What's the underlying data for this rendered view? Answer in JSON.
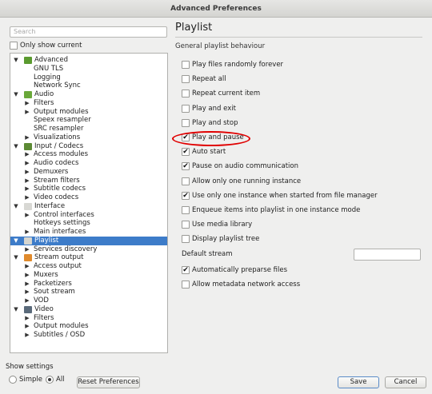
{
  "window": {
    "title": "Advanced Preferences"
  },
  "search": {
    "placeholder": "Search"
  },
  "only_show_current": {
    "label": "Only show current",
    "checked": false
  },
  "tree": [
    {
      "label": "Advanced",
      "level": 0,
      "expanded": true,
      "icon": "advanced-icon",
      "color": "#5a9a2f"
    },
    {
      "label": "GNU TLS",
      "level": 1
    },
    {
      "label": "Logging",
      "level": 1
    },
    {
      "label": "Network Sync",
      "level": 1
    },
    {
      "label": "Audio",
      "level": 0,
      "expanded": true,
      "icon": "audio-icon",
      "color": "#6aa83a"
    },
    {
      "label": "Filters",
      "level": 1,
      "collapsed": true
    },
    {
      "label": "Output modules",
      "level": 1,
      "collapsed": true
    },
    {
      "label": "Speex resampler",
      "level": 1
    },
    {
      "label": "SRC resampler",
      "level": 1
    },
    {
      "label": "Visualizations",
      "level": 1,
      "collapsed": true
    },
    {
      "label": "Input / Codecs",
      "level": 0,
      "expanded": true,
      "icon": "input-codecs-icon",
      "color": "#5c8a34"
    },
    {
      "label": "Access modules",
      "level": 1,
      "collapsed": true
    },
    {
      "label": "Audio codecs",
      "level": 1,
      "collapsed": true
    },
    {
      "label": "Demuxers",
      "level": 1,
      "collapsed": true
    },
    {
      "label": "Stream filters",
      "level": 1,
      "collapsed": true
    },
    {
      "label": "Subtitle codecs",
      "level": 1,
      "collapsed": true
    },
    {
      "label": "Video codecs",
      "level": 1,
      "collapsed": true
    },
    {
      "label": "Interface",
      "level": 0,
      "expanded": true,
      "icon": "interface-icon",
      "color": "#d8d8d4"
    },
    {
      "label": "Control interfaces",
      "level": 1,
      "collapsed": true
    },
    {
      "label": "Hotkeys settings",
      "level": 1
    },
    {
      "label": "Main interfaces",
      "level": 1,
      "collapsed": true
    },
    {
      "label": "Playlist",
      "level": 0,
      "expanded": true,
      "selected": true,
      "icon": "playlist-icon",
      "color": "#d6d6d0"
    },
    {
      "label": "Services discovery",
      "level": 1,
      "collapsed": true
    },
    {
      "label": "Stream output",
      "level": 0,
      "expanded": true,
      "icon": "stream-output-icon",
      "color": "#e08a2c"
    },
    {
      "label": "Access output",
      "level": 1,
      "collapsed": true
    },
    {
      "label": "Muxers",
      "level": 1,
      "collapsed": true
    },
    {
      "label": "Packetizers",
      "level": 1,
      "collapsed": true
    },
    {
      "label": "Sout stream",
      "level": 1,
      "collapsed": true
    },
    {
      "label": "VOD",
      "level": 1,
      "collapsed": true
    },
    {
      "label": "Video",
      "level": 0,
      "expanded": true,
      "icon": "video-icon",
      "color": "#5a6a7a"
    },
    {
      "label": "Filters",
      "level": 1,
      "collapsed": true
    },
    {
      "label": "Output modules",
      "level": 1,
      "collapsed": true
    },
    {
      "label": "Subtitles / OSD",
      "level": 1,
      "collapsed": true
    }
  ],
  "panel": {
    "title": "Playlist",
    "section": "General playlist behaviour",
    "options": [
      {
        "label": "Play files randomly forever",
        "checked": false
      },
      {
        "label": "Repeat all",
        "checked": false
      },
      {
        "label": "Repeat current item",
        "checked": false
      },
      {
        "label": "Play and exit",
        "checked": false
      },
      {
        "label": "Play and stop",
        "checked": false
      },
      {
        "label": "Play and pause",
        "checked": true
      },
      {
        "label": "Auto start",
        "checked": true
      },
      {
        "label": "Pause on audio communication",
        "checked": true
      },
      {
        "label": "Allow only one running instance",
        "checked": false
      },
      {
        "label": "Use only one instance when started from file manager",
        "checked": true
      },
      {
        "label": "Enqueue items into playlist in one instance mode",
        "checked": false
      },
      {
        "label": "Use media library",
        "checked": false
      },
      {
        "label": "Display playlist tree",
        "checked": false
      }
    ],
    "default_stream_label": "Default stream",
    "default_stream_value": "",
    "options2": [
      {
        "label": "Automatically preparse files",
        "checked": true
      },
      {
        "label": "Allow metadata network access",
        "checked": false
      }
    ]
  },
  "show_settings": {
    "label": "Show settings",
    "simple": "Simple",
    "all": "All",
    "selected": "All"
  },
  "buttons": {
    "reset": "Reset Preferences",
    "save": "Save",
    "cancel": "Cancel"
  },
  "colors": {
    "selection": "#3d7cc9",
    "highlight_ring": "#e00000"
  }
}
